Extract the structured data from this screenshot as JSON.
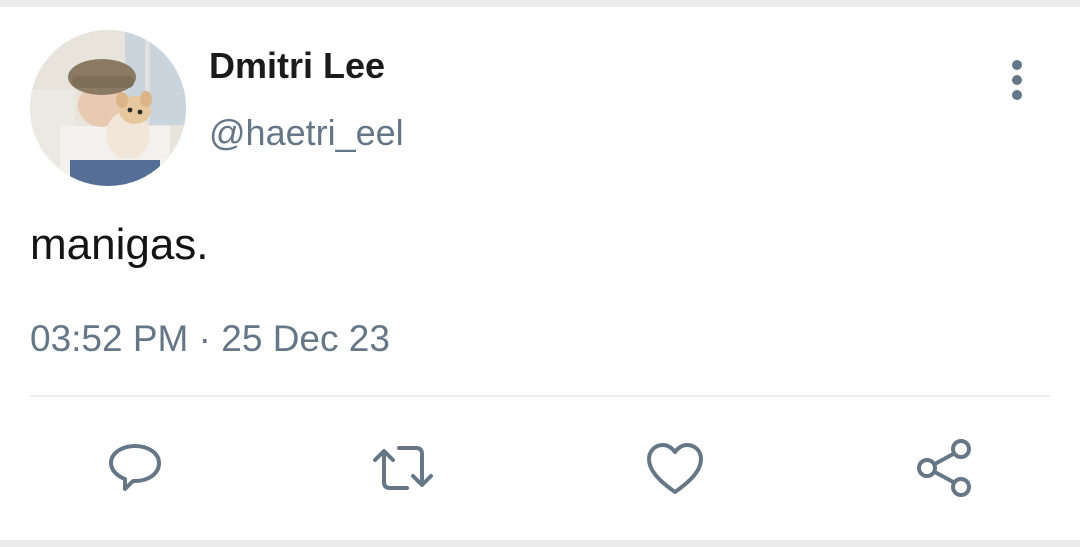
{
  "tweet": {
    "author_name": "Dmitri Lee",
    "author_handle": "@haetri_eel",
    "text": "manigas.",
    "time": "03:52 PM",
    "separator": "·",
    "date": "25 Dec 23"
  },
  "icons": {
    "more": "more-vertical-icon",
    "reply": "reply-icon",
    "retweet": "retweet-icon",
    "like": "heart-icon",
    "share": "share-icon"
  },
  "colors": {
    "text_primary": "#141414",
    "text_secondary": "#657786",
    "icon": "#657786",
    "divider": "#e6ecf0"
  }
}
